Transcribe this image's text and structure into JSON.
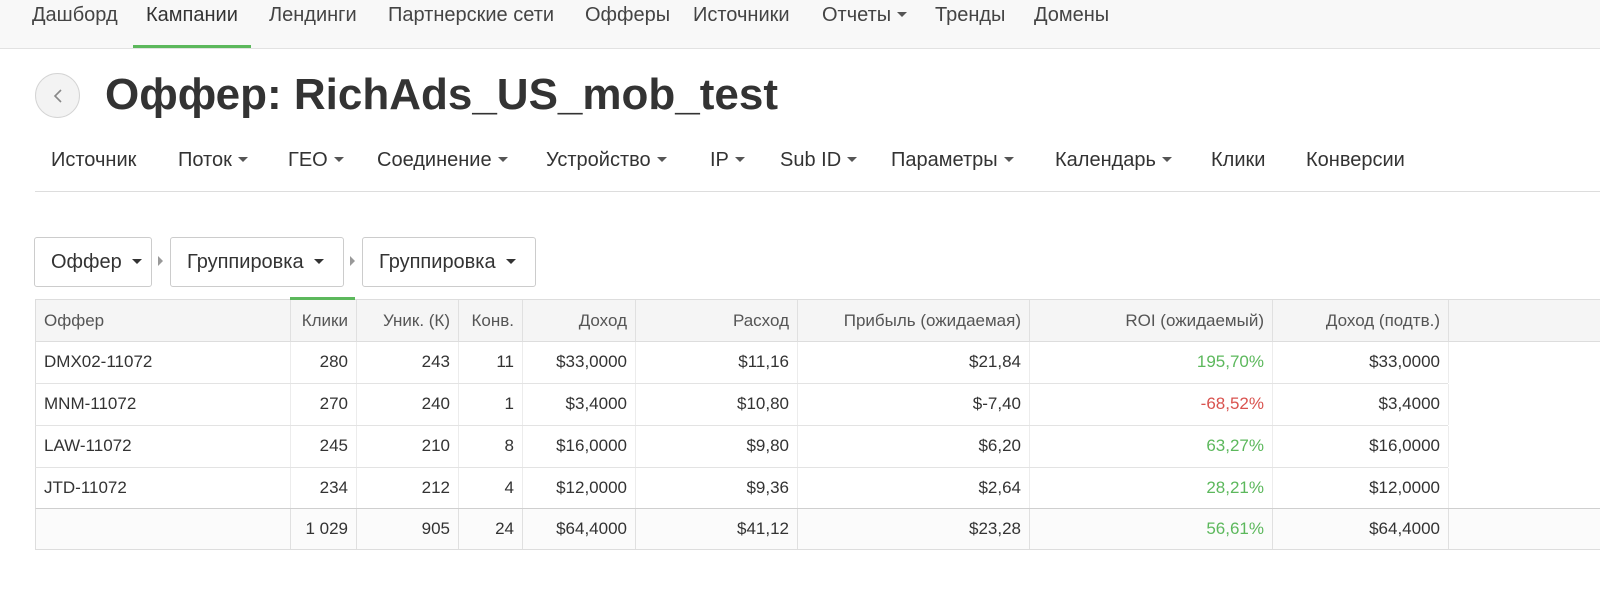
{
  "topnav": {
    "items": [
      {
        "label": "Дашборд"
      },
      {
        "label": "Кампании"
      },
      {
        "label": "Лендинги"
      },
      {
        "label": "Партнерские сети"
      },
      {
        "label": "Офферы"
      },
      {
        "label": "Источники"
      },
      {
        "label": "Отчеты"
      },
      {
        "label": "Тренды"
      },
      {
        "label": "Домены"
      }
    ],
    "active_index": 1
  },
  "page": {
    "title": "Оффер: RichAds_US_mob_test"
  },
  "subnav": {
    "items": [
      {
        "label": "Источник"
      },
      {
        "label": "Поток"
      },
      {
        "label": "ГЕО"
      },
      {
        "label": "Соединение"
      },
      {
        "label": "Устройство"
      },
      {
        "label": "IP"
      },
      {
        "label": "Sub ID"
      },
      {
        "label": "Параметры"
      },
      {
        "label": "Календарь"
      },
      {
        "label": "Клики"
      },
      {
        "label": "Конверсии"
      }
    ]
  },
  "grouping": {
    "first": "Оффер",
    "second": "Группировка",
    "third": "Группировка"
  },
  "table": {
    "headers": [
      "Оффер",
      "Клики",
      "Уник. (К)",
      "Конв.",
      "Доход",
      "Расход",
      "Прибыль (ожидаемая)",
      "ROI (ожидаемый)",
      "Доход (подтв.)"
    ],
    "rows": [
      [
        "DMX02-11072",
        "280",
        "243",
        "11",
        "$33,0000",
        "$11,16",
        "$21,84",
        "195,70%",
        "$33,0000"
      ],
      [
        "MNM-11072",
        "270",
        "240",
        "1",
        "$3,4000",
        "$10,80",
        "$-7,40",
        "-68,52%",
        "$3,4000"
      ],
      [
        "LAW-11072",
        "245",
        "210",
        "8",
        "$16,0000",
        "$9,80",
        "$6,20",
        "63,27%",
        "$16,0000"
      ],
      [
        "JTD-11072",
        "234",
        "212",
        "4",
        "$12,0000",
        "$9,36",
        "$2,64",
        "28,21%",
        "$12,0000"
      ]
    ],
    "total": [
      "",
      "1 029",
      "905",
      "24",
      "$64,4000",
      "$41,12",
      "$23,28",
      "56,61%",
      "$64,4000"
    ],
    "colors": {
      "positive": "#5cb85c",
      "negative": "#d9534f",
      "accent": "#5cb85c"
    }
  }
}
